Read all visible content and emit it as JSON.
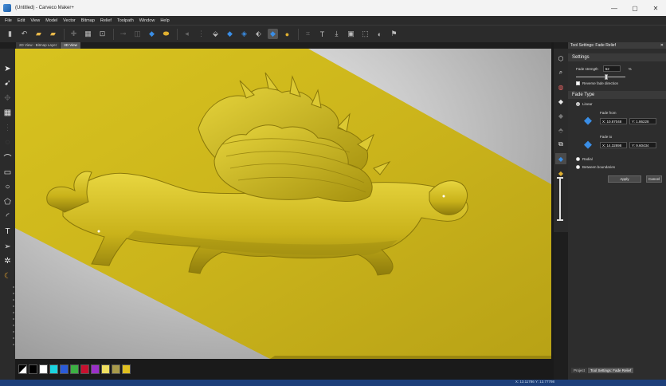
{
  "window": {
    "title": "(Untitled) - Carveco Maker+",
    "controls": [
      "—",
      "▢",
      "✕"
    ]
  },
  "menu": [
    "File",
    "Edit",
    "View",
    "Model",
    "Vector",
    "Bitmap",
    "Relief",
    "Toolpath",
    "Window",
    "Help"
  ],
  "view_tabs": [
    {
      "label": "2D View - Bitmap Layer"
    },
    {
      "label": "3D View"
    }
  ],
  "palette": [
    "#000000",
    "#ffffff",
    "#1ad4e0",
    "#2a5bd8",
    "#3cb043",
    "#c8102e",
    "#9b30c8",
    "#f0e060",
    "#a89a4a",
    "#e0c020"
  ],
  "panel": {
    "header": "Tool Settings: Fade Relief",
    "settings": {
      "title": "Settings",
      "fade_strength_label": "Fade strength",
      "fade_strength_value": "62",
      "fade_strength_unit": "%",
      "fade_strength_level": 0.62,
      "reverse_label": "Reverse fade direction"
    },
    "fade_type": {
      "title": "Fade Type",
      "linear_label": "Linear",
      "fade_from_label": "Fade from",
      "from_x_label": "X:",
      "from_x": "10.87048",
      "from_y_label": "Y:",
      "from_y": "1.86228",
      "fade_to_label": "Fade to",
      "to_x_label": "X:",
      "to_x": "14.32898",
      "to_y_label": "Y:",
      "to_y": "9.60434",
      "radial_label": "Radial",
      "between_label": "Between boundaries"
    },
    "apply_label": "Apply",
    "cancel_label": "Cancel"
  },
  "bottom_tabs": [
    {
      "label": "Project"
    },
    {
      "label": "Tool Settings: Fade Relief"
    }
  ],
  "status": {
    "coords": "X: 13.11786  Y: 13.77798"
  },
  "colors": {
    "relief": "#c9b21a",
    "panel": "#2d2d2d",
    "status": "#1d3f7a"
  }
}
